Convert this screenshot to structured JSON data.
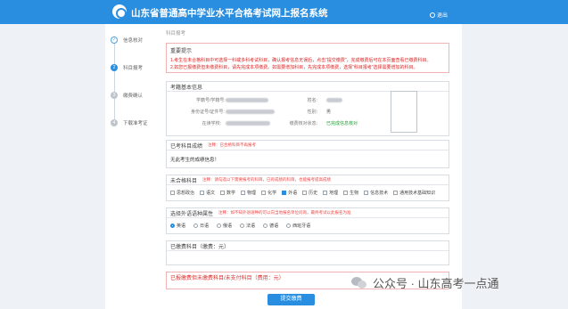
{
  "header": {
    "title": "山东省普通高中学业水平合格考试网上报名系统",
    "exit_label": "退出",
    "logo_icon": "school-seal-icon"
  },
  "steps": [
    {
      "label": "信息核对",
      "marker": "✓"
    },
    {
      "label": "科目报考",
      "marker": "2"
    },
    {
      "label": "缴费确认",
      "marker": "3"
    },
    {
      "label": "下载准考证",
      "marker": "4"
    }
  ],
  "breadcrumb": "科目报考",
  "notice": {
    "title": "重要提示",
    "lines": [
      "1.考生在未合格科目中可选择一科或多科考试科目，确认报考信息无误后，点击“提交缴费”，完成缴费后可在本页面查看已缴费科目。",
      "2.如您已报缴费但未缴费科目，请先完成本项缴费。如需要增加科目，先完成本项缴费，选择“科目报考”选择需要增加的科目。"
    ]
  },
  "basic_info": {
    "title": "考籍基本信息",
    "fields": [
      {
        "label": "学籍号/学籍号:"
      },
      {
        "label": "身份证号/证件号:"
      },
      {
        "label": "在读学校:"
      }
    ],
    "name_label": "姓名:",
    "gender_label": "性别:",
    "gender_value": "男",
    "status_label": "缴费核对状态:",
    "status_value": "已完成信息核对"
  },
  "selected": {
    "title": "已考科目成绩",
    "note": "注释：已合格科目不再报考",
    "text": "无此考生的成绩信息！"
  },
  "unpassed": {
    "title": "未合格科目",
    "note": "注释：请勾选以下需要报考的科目，已有成绩的科目，也能报考提高成绩",
    "options": [
      {
        "label": "思想政治",
        "checked": false
      },
      {
        "label": "语文",
        "checked": false
      },
      {
        "label": "数学",
        "checked": false
      },
      {
        "label": "物理",
        "checked": false
      },
      {
        "label": "化学",
        "checked": false
      },
      {
        "label": "外语",
        "checked": true
      },
      {
        "label": "历史",
        "checked": false
      },
      {
        "label": "地理",
        "checked": false
      },
      {
        "label": "生物",
        "checked": false
      },
      {
        "label": "信息技术",
        "checked": false
      },
      {
        "label": "通用技术基础知识",
        "checked": false
      }
    ]
  },
  "language": {
    "title": "选择外语语种属性",
    "note": "注释：如不知外语语种的可以向当地报名单位问询，最终考试以此报名为准",
    "options": [
      {
        "label": "英语",
        "selected": true
      },
      {
        "label": "日语",
        "selected": false
      },
      {
        "label": "俄语",
        "selected": false
      },
      {
        "label": "法语",
        "selected": false
      },
      {
        "label": "德语",
        "selected": false
      },
      {
        "label": "西班牙语",
        "selected": false
      }
    ]
  },
  "paid": {
    "title": "已缴费科目（缴费：元）"
  },
  "unpaid": {
    "title": "已报缴费但未缴费科目/未支付科目（费用：元）"
  },
  "submit_label": "提交缴费",
  "watermark": "公众号 · 山东高考一点通",
  "colors": {
    "header": "#2a8ee0",
    "accent": "#2a8ee0",
    "danger": "#e03030",
    "success": "#21a034"
  }
}
